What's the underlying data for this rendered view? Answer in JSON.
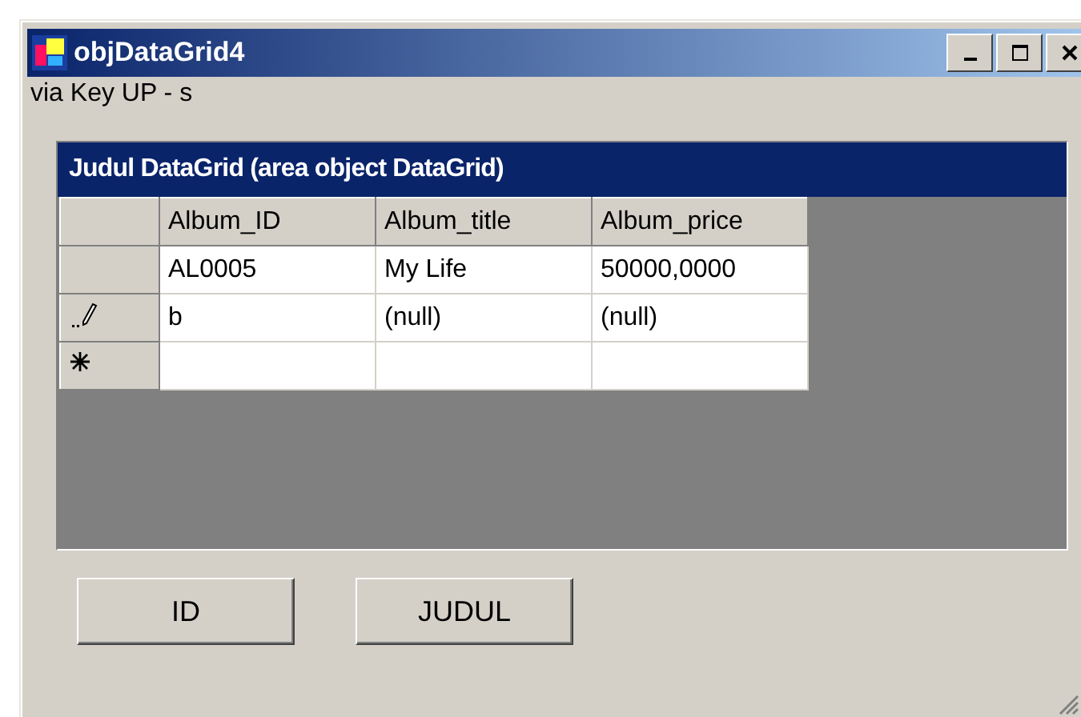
{
  "window": {
    "title": "objDataGrid4"
  },
  "label": "via Key UP - s",
  "grid": {
    "caption": "Judul DataGrid (area object DataGrid)",
    "columns": [
      "Album_ID",
      "Album_title",
      "Album_price"
    ],
    "rows": [
      {
        "kind": "data",
        "cells": [
          "AL0005",
          "My Life",
          "50000,0000"
        ]
      },
      {
        "kind": "editing",
        "cells": [
          "b",
          "(null)",
          "(null)"
        ]
      },
      {
        "kind": "new"
      }
    ]
  },
  "buttons": [
    "ID",
    "JUDUL"
  ]
}
